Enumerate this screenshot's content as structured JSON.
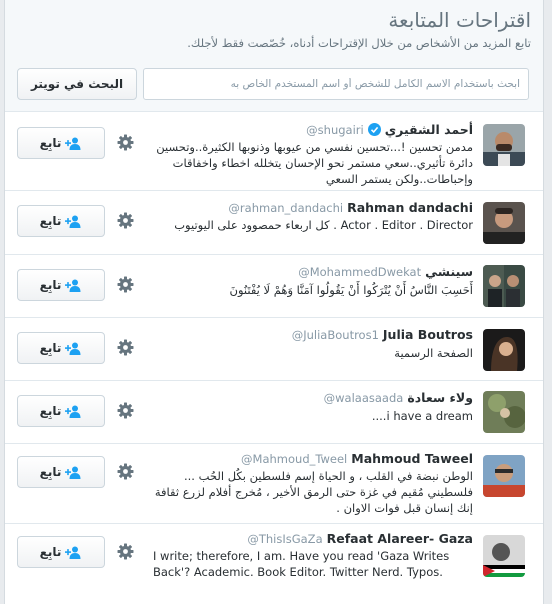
{
  "header": {
    "title": "اقتراحات المتابعة",
    "subtitle": "تابع المزيد من الأشخاص من خلال الإقتراحات أدناه، خُصّصت فقط لأجلك.",
    "search_placeholder": "ابحث باستخدام الاسم الكامل للشخص أو اسم المستخدم الخاص به",
    "search_button_label": "البحث في تويتر"
  },
  "follow_label": "تابِع",
  "colors": {
    "accent": "#1da1f2",
    "verified": "#1da1f2",
    "muted": "#8899a6"
  },
  "suggestions": [
    {
      "name": "أحمد الشقيري",
      "handle": "@shugairi",
      "verified": true,
      "bio": "مدمن تحسين !...تحسين نفسي من عيوبها وذنوبها الكثيرة..وتحسين دائرة تأثيري..سعي مستمر نحو الإحسان يتخلله اخطاء واخفاقات وإحباطات..ولكن يستمر السعي"
    },
    {
      "name": "Rahman dandachi",
      "handle": "@rahman_dandachi",
      "verified": false,
      "bio": "Actor . Editor . Director . كل اربعاء حمصوود على اليوتيوب"
    },
    {
      "name": "سينشي",
      "handle": "@MohammedDwekat",
      "verified": false,
      "bio": "أَحَسِبَ النَّاسُ أَنْ يُتْرَكُوا أَنْ يَقُولُوا آمَنَّا وَهُمْ لَا يُفْتَنُونَ"
    },
    {
      "name": "Julia Boutros",
      "handle": "@JuliaBoutros1",
      "verified": false,
      "bio": "الصفحة الرسمية"
    },
    {
      "name": "ولاء سعادة",
      "handle": "@walaasaada",
      "verified": false,
      "bio": "i have a dream...."
    },
    {
      "name": "Mahmoud Taweel",
      "handle": "@Mahmoud_Tweel",
      "verified": false,
      "bio": "الوطن نبضة في القلب ، و الحياة إسم فلسطين بكُل الحُب ... فلسطيني مُقيم في غزة حتى الرمق الأخير ، مُخرج أفلام لزرع ثقافة إنك إنسان قبل فوات الاوان ."
    },
    {
      "name": "Refaat Alareer- Gaza",
      "handle": "@ThisIsGaZa",
      "verified": false,
      "bio": "I write; therefore, I am. Have you read 'Gaza Writes Back'? Academic. Book Editor. Twitter Nerd. Typos."
    }
  ]
}
